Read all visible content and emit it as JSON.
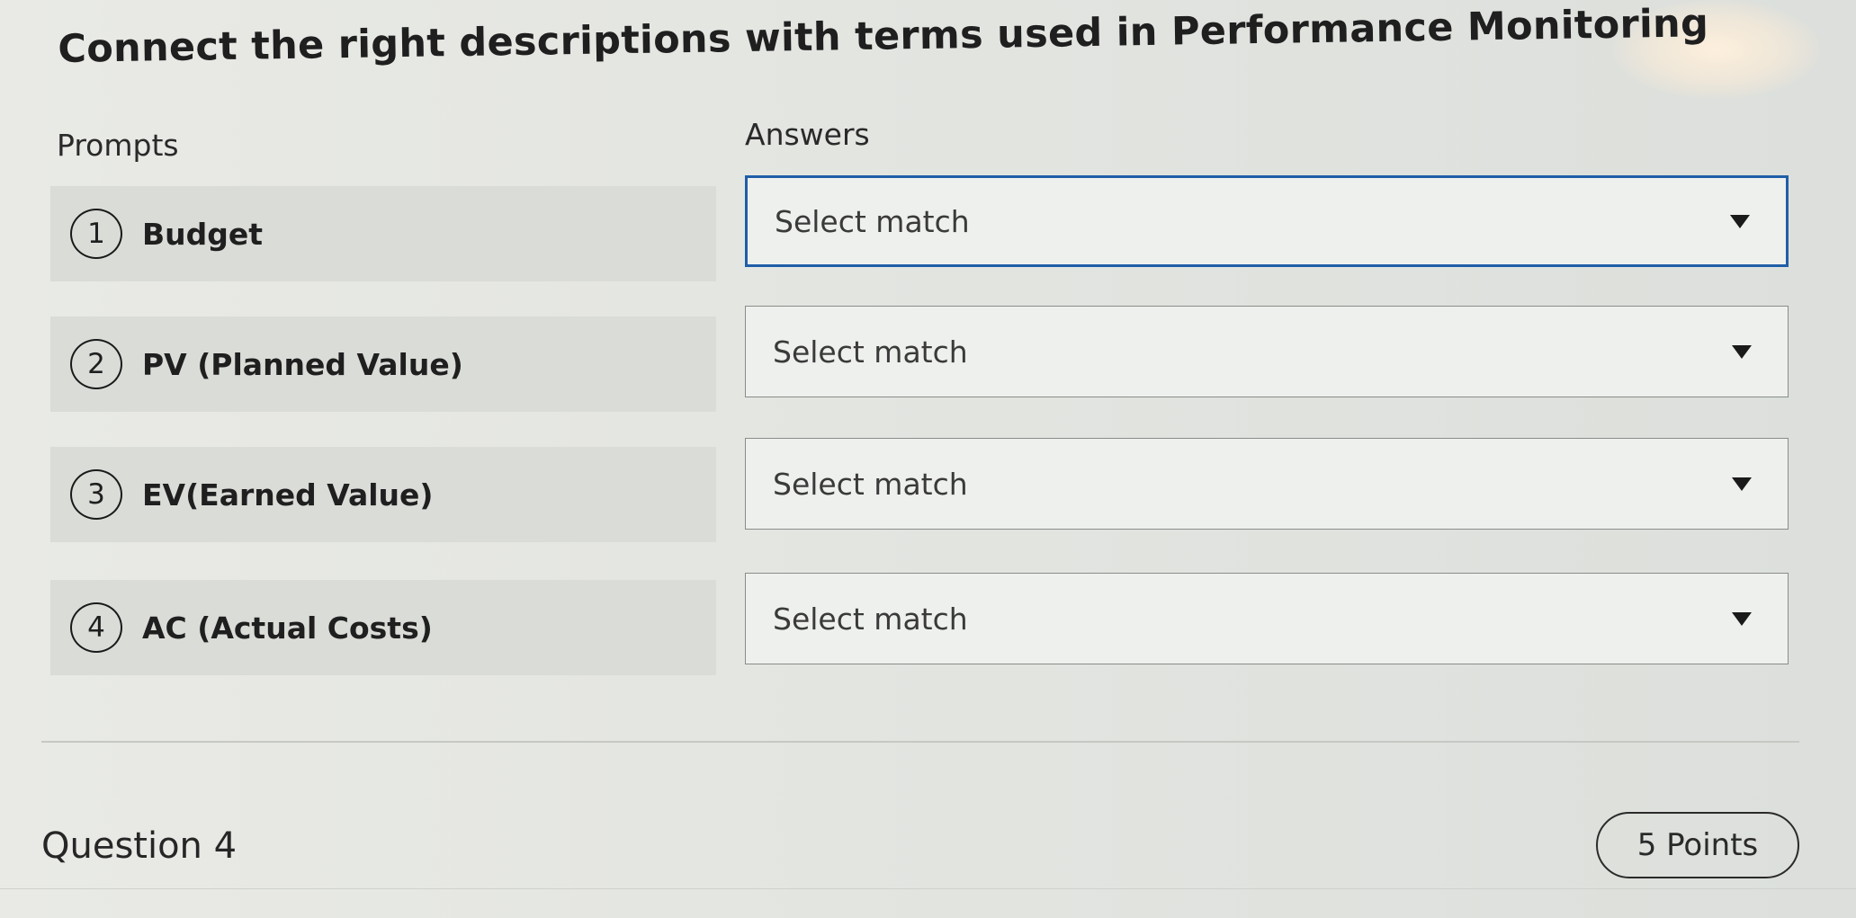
{
  "question": {
    "title": "Connect the right descriptions with terms used in Performance Monitoring",
    "prompts_label": "Prompts",
    "answers_label": "Answers",
    "rows": [
      {
        "number": "1",
        "prompt": "Budget",
        "answer": "Select match"
      },
      {
        "number": "2",
        "prompt": "PV (Planned Value)",
        "answer": "Select match"
      },
      {
        "number": "3",
        "prompt": "EV(Earned Value)",
        "answer": "Select match"
      },
      {
        "number": "4",
        "prompt": "AC (Actual Costs)",
        "answer": "Select match"
      }
    ]
  },
  "footer": {
    "question_label": "Question 4",
    "points": "5 Points"
  },
  "icons": {
    "dropdown": "chevron-down-icon"
  },
  "colors": {
    "focus_border": "#1f5ea8",
    "prompt_background": "#dadcd8"
  }
}
